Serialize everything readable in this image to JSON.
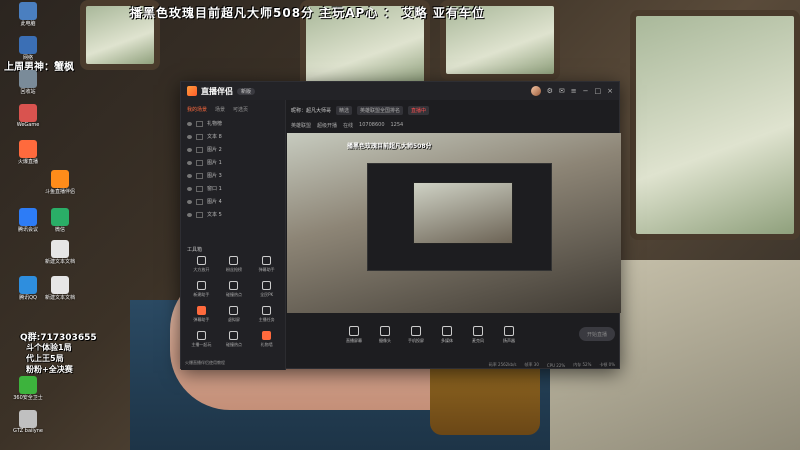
{
  "overlay": {
    "title": "播黑色玫瑰目前超凡大师508分     主玩AP心 ：   艾略  亚有车位",
    "left_weekly": "上周男神：蟹枫",
    "left_qq": "Q群:717303655",
    "left_1": "斗个体验1局",
    "left_2": "代上王5局",
    "left_3": "粉粉+全决赛"
  },
  "desktop_icons": [
    {
      "label": "此电脑",
      "color": "#4a7fc0"
    },
    {
      "label": "网络",
      "color": "#3b6fb5"
    },
    {
      "label": "回收站",
      "color": "#7a8b99"
    },
    {
      "label": "WeGame",
      "color": "#d9534f"
    },
    {
      "label": "火爆直播",
      "color": "#ff6a3d"
    },
    {
      "label": "斗鱼直播伴侣",
      "color": "#ff8c1a"
    },
    {
      "label": "腾讯会议",
      "color": "#2d7cf6"
    },
    {
      "label": "微信",
      "color": "#2aae67"
    },
    {
      "label": "新建文本文档",
      "color": "#e6e6e6"
    },
    {
      "label": "腾讯QQ",
      "color": "#2e8ede"
    },
    {
      "label": "新建文本文档",
      "color": "#e6e6e6"
    },
    {
      "label": "360安全卫士",
      "color": "#3db33d"
    },
    {
      "label": "GTZ bailyne",
      "color": "#c0c0c0"
    }
  ],
  "app": {
    "brand": "直播伴侣",
    "version": "新版",
    "left_tabs": [
      "我的场景",
      "场景",
      "可选页"
    ],
    "scenes": [
      "礼物榜",
      "文本 8",
      "图片 2",
      "图片 1",
      "图片 3",
      "窗口 1",
      "图片 4",
      "文本 5"
    ],
    "tools_title": "工具箱",
    "tools": [
      {
        "label": "大方放开"
      },
      {
        "label": "粉丝抢榜"
      },
      {
        "label": "弹幕助手"
      },
      {
        "label": "新建助手"
      },
      {
        "label": "碰撞热点"
      },
      {
        "label": "全民PK"
      },
      {
        "label": "弹幕助手",
        "hot": true
      },
      {
        "label": "虚拟屏"
      },
      {
        "label": "主播任务"
      },
      {
        "label": "主播一起玩"
      },
      {
        "label": "碰撞热点"
      },
      {
        "label": "礼物墙",
        "hot": true
      }
    ],
    "left_footer": "火爆直播伴侣使用教程",
    "header": {
      "room_label": "昵称：超凡大师哥",
      "tag": "精选",
      "category": "英雄联盟全国排名",
      "live_tag": "直播中"
    },
    "sub_tabs": [
      "英雄联盟",
      "超级开播",
      "在线",
      "10708600",
      "1254"
    ],
    "preview_text": "播黑色玫瑰目前超凡大师508分",
    "controls": [
      {
        "label": "直播屏幕"
      },
      {
        "label": "摄像头"
      },
      {
        "label": "手机投屏"
      },
      {
        "label": "多媒体"
      },
      {
        "label": "麦克风"
      },
      {
        "label": "扬声器"
      }
    ],
    "start_button": "开始直播",
    "status": [
      "码率 2562kb/s",
      "帧率 30",
      "CPU 22%",
      "内存 52%",
      "卡顿 0%"
    ]
  }
}
